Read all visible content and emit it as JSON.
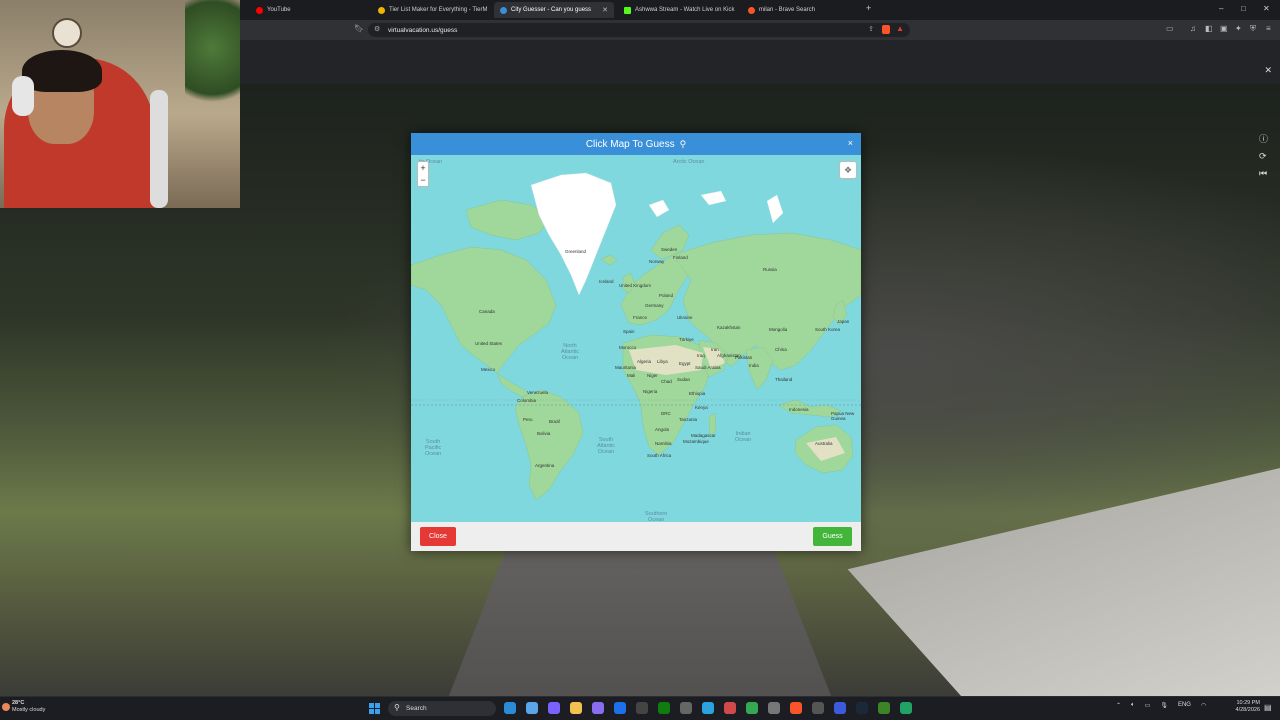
{
  "browser": {
    "tabs": [
      {
        "label": "YouTube",
        "favicon_color": "#ff0000",
        "active": false
      },
      {
        "label": "Tier List Maker for Everything - TierM",
        "favicon_color": "#f0b400",
        "active": false
      },
      {
        "label": "City Guesser - Can you guess",
        "favicon_color": "#3a8fd9",
        "active": true
      },
      {
        "label": "Ashwwa Stream - Watch Live on Kick",
        "favicon_color": "#53fc18",
        "active": false
      },
      {
        "label": "milan - Brave Search",
        "favicon_color": "#fb542b",
        "active": false
      }
    ],
    "new_tab": "+",
    "window_controls": {
      "minimize": "–",
      "maximize": "□",
      "close": "✕"
    },
    "url": "virtualvacation.us/guess"
  },
  "page": {
    "close_icon": "✕",
    "modal": {
      "title": "Click Map To Guess",
      "title_icon": "map-marker",
      "close": "×",
      "zoom_in": "+",
      "zoom_out": "−",
      "close_button": "Close",
      "guess_button": "Guess",
      "header_color": "#3a8fd9",
      "close_color": "#e53935",
      "guess_color": "#43b53a"
    },
    "map_labels": {
      "arctic_left": "tic Ocean",
      "arctic": "Arctic Ocean",
      "north_atlantic": "North\nAtlantic\nOcean",
      "south_pacific": "South\nPacific\nOcean",
      "south_atlantic": "South\nAtlantic\nOcean",
      "indian": "Indian\nOcean",
      "southern": "Southern\nOcean",
      "greenland": "Greenland",
      "iceland": "Iceland",
      "canada": "Canada",
      "united_states": "United States",
      "mexico": "Mexico",
      "venezuela": "Venezuela",
      "colombia": "Colombia",
      "peru": "Peru",
      "brazil": "Brazil",
      "bolivia": "Bolivia",
      "argentina": "Argentina",
      "russia": "Russia",
      "kazakhstan": "Kazakhstan",
      "mongolia": "Mongolia",
      "china": "China",
      "india": "India",
      "iran": "Iran",
      "afghanistan": "Afghanistan",
      "algeria": "Algeria",
      "libya": "Libya",
      "egypt": "Egypt",
      "mali": "Mali",
      "niger": "Niger",
      "chad": "Chad",
      "sudan": "Sudan",
      "ethiopia": "Ethiopia",
      "nigeria": "Nigeria",
      "drc": "DRC",
      "tanzania": "Tanzania",
      "angola": "Angola",
      "namibia": "Namibia",
      "south_africa": "South Africa",
      "madagascar": "Madagascar",
      "indonesia": "Indonesia",
      "papua": "Papua New Guinea",
      "australia": "Australia",
      "south_korea": "South Korea",
      "japan": "Japan",
      "thailand": "Thailand",
      "saudi_arabia": "Saudi Arabia",
      "turkey": "Türkiye",
      "ukraine": "Ukraine",
      "germany": "Germany",
      "france": "France",
      "spain": "Spain",
      "sweden": "Sweden",
      "finland": "Finland",
      "norway": "Norway",
      "uk": "United Kingdom",
      "poland": "Poland",
      "iraq": "Iraq",
      "pakistan": "Pakistan",
      "morocco": "Morocco",
      "mauritania": "Mauritania",
      "kenya": "Kenya",
      "mozambique": "Mozambique"
    },
    "right_controls": [
      "ⓘ",
      "⟳",
      "⏮"
    ]
  },
  "taskbar": {
    "weather_temp": "28°C",
    "weather_desc": "Mostly cloudy",
    "search_label": "Search",
    "tray_lang": "ENG",
    "time": "10:29 PM",
    "date": "4/28/2026"
  }
}
